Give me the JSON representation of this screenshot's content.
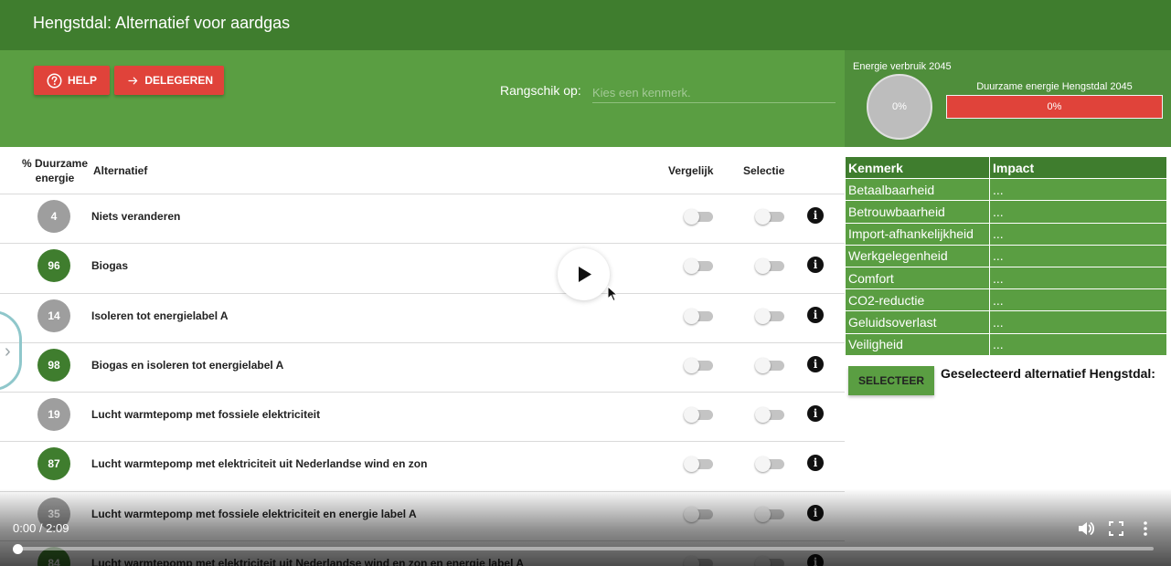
{
  "header": {
    "title": "Hengstdal: Alternatief voor aardgas"
  },
  "toolbar": {
    "help_label": "HELP",
    "delegate_label": "DELEGEREN",
    "sort_label": "Rangschik op:",
    "sort_placeholder": "Kies een kenmerk."
  },
  "energy": {
    "usage_title": "Energie verbruik 2045",
    "usage_value": "0%",
    "sustainable_title": "Duurzame energie Hengstdal 2045",
    "sustainable_value": "0%"
  },
  "list": {
    "col_pct_line1": "% Duurzame",
    "col_pct_line2": "energie",
    "col_alternative": "Alternatief",
    "col_compare": "Vergelijk",
    "col_select": "Selectie",
    "rows": [
      {
        "pct": "4",
        "color": "grey",
        "label": "Niets veranderen"
      },
      {
        "pct": "96",
        "color": "green",
        "label": "Biogas"
      },
      {
        "pct": "14",
        "color": "grey",
        "label": "Isoleren tot energielabel A"
      },
      {
        "pct": "98",
        "color": "green",
        "label": "Biogas en isoleren tot energielabel A"
      },
      {
        "pct": "19",
        "color": "grey",
        "label": "Lucht warmtepomp met fossiele elektriciteit"
      },
      {
        "pct": "87",
        "color": "green",
        "label": "Lucht warmtepomp met elektriciteit uit Nederlandse wind en zon"
      },
      {
        "pct": "35",
        "color": "grey",
        "label": "Lucht warmtepomp met fossiele elektriciteit en energie label A"
      },
      {
        "pct": "84",
        "color": "green",
        "label": "Lucht warmtepomp met elektriciteit uit Nederlandse wind en zon en energie label A"
      }
    ]
  },
  "kenmerk_table": {
    "header_kenmerk": "Kenmerk",
    "header_impact": "Impact",
    "rows": [
      {
        "kenmerk": "Betaalbaarheid",
        "impact": "..."
      },
      {
        "kenmerk": "Betrouwbaarheid",
        "impact": "..."
      },
      {
        "kenmerk": "Import-afhankelijkheid",
        "impact": "..."
      },
      {
        "kenmerk": "Werkgelegenheid",
        "impact": "..."
      },
      {
        "kenmerk": "Comfort",
        "impact": "..."
      },
      {
        "kenmerk": "CO2-reductie",
        "impact": "..."
      },
      {
        "kenmerk": "Geluidsoverlast",
        "impact": "..."
      },
      {
        "kenmerk": "Veiligheid",
        "impact": "..."
      }
    ]
  },
  "selection": {
    "button_label": "SELECTEER",
    "selected_label": "Geselecteerd alternatief Hengstdal:"
  },
  "video": {
    "time": "0:00 / 2:09",
    "progress_fraction": 0.005
  },
  "colors": {
    "header_green": "#3f7d2e",
    "toolbar_green": "#5a9e42",
    "accent_red": "#e0433a",
    "badge_grey": "#9e9e9e"
  },
  "icons": {
    "help": "help-circle-icon",
    "delegate": "arrow-right-icon",
    "info": "info-icon",
    "play": "play-icon",
    "volume": "volume-icon",
    "fullscreen": "fullscreen-icon",
    "more": "more-vert-icon"
  }
}
